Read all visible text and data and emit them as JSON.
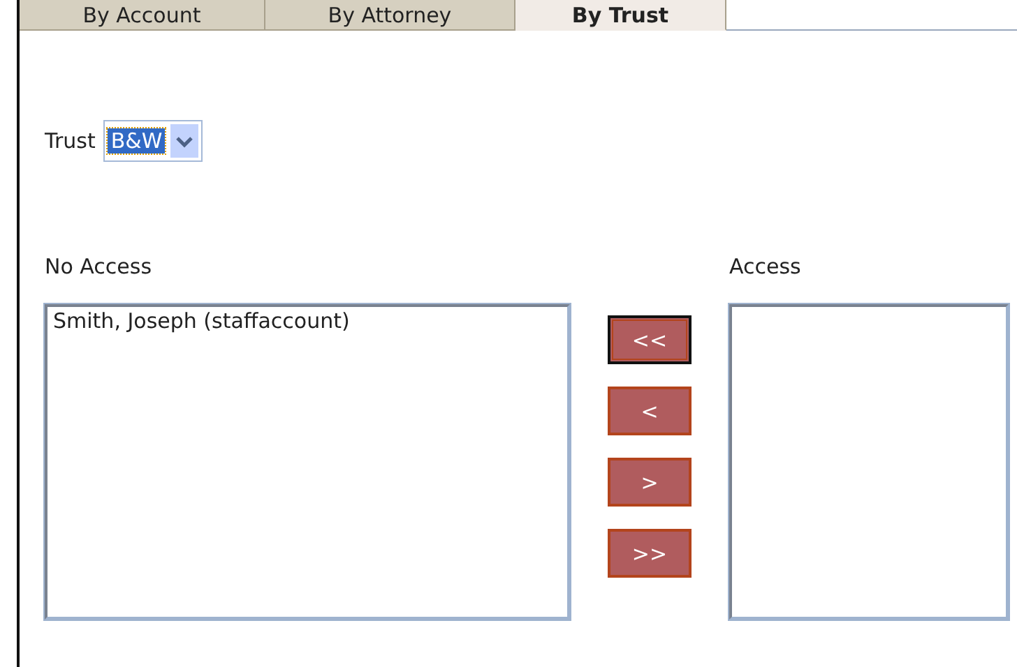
{
  "tabs": [
    {
      "label": "By Account",
      "selected": false
    },
    {
      "label": "By Attorney",
      "selected": false
    },
    {
      "label": "By Trust",
      "selected": true
    }
  ],
  "trust": {
    "label": "Trust",
    "value": "B&W"
  },
  "no_access": {
    "label": "No Access",
    "items": [
      "Smith, Joseph (staffaccount)"
    ]
  },
  "move_buttons": [
    {
      "label": "<<",
      "focused": true
    },
    {
      "label": "<",
      "focused": false
    },
    {
      "label": ">",
      "focused": false
    },
    {
      "label": ">>",
      "focused": false
    }
  ],
  "access": {
    "label": "Access"
  }
}
